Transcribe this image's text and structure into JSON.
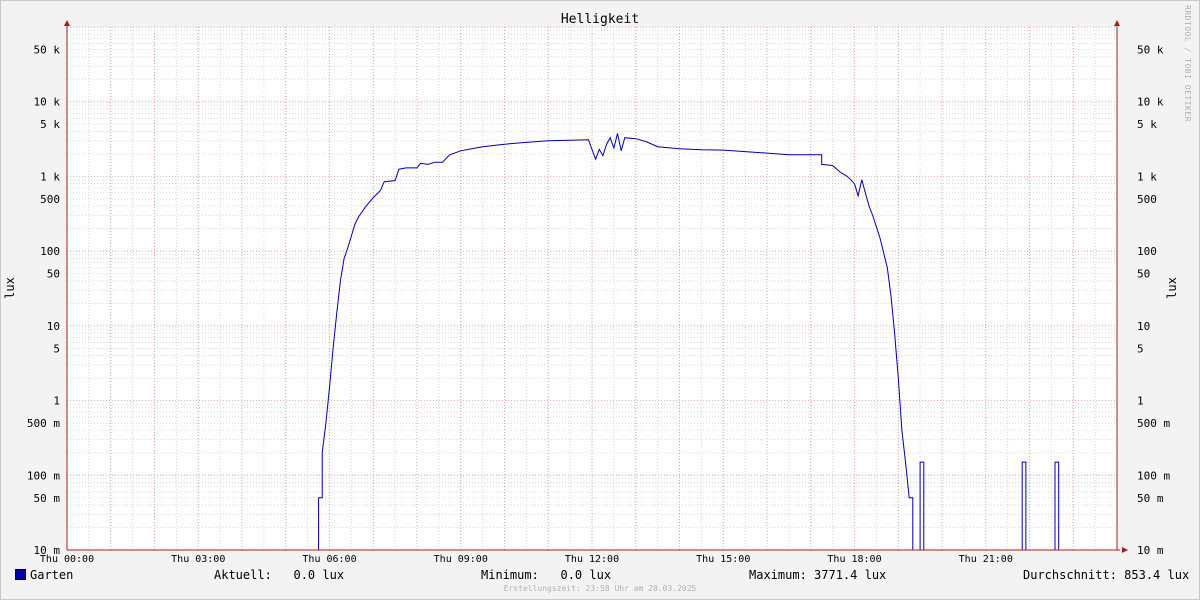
{
  "chart_data": {
    "type": "line",
    "title": "Helligkeit",
    "ylabel": "lux",
    "yscale": "log",
    "ylim": [
      0.01,
      100000
    ],
    "xlim": [
      "Thu 00:00",
      "Thu 24:00"
    ],
    "x_tick_labels": [
      "Thu 00:00",
      "Thu 03:00",
      "Thu 06:00",
      "Thu 09:00",
      "Thu 12:00",
      "Thu 15:00",
      "Thu 18:00",
      "Thu 21:00"
    ],
    "y_ticks": [
      {
        "v": 50000,
        "label": "50 k"
      },
      {
        "v": 10000,
        "label": "10 k"
      },
      {
        "v": 5000,
        "label": "5 k"
      },
      {
        "v": 1000,
        "label": "1 k"
      },
      {
        "v": 500,
        "label": "500"
      },
      {
        "v": 100,
        "label": "100"
      },
      {
        "v": 50,
        "label": "50"
      },
      {
        "v": 10,
        "label": "10"
      },
      {
        "v": 5,
        "label": "5"
      },
      {
        "v": 1,
        "label": "1"
      },
      {
        "v": 0.5,
        "label": "500 m"
      },
      {
        "v": 0.1,
        "label": "100 m"
      },
      {
        "v": 0.05,
        "label": "50 m"
      },
      {
        "v": 0.01,
        "label": "10 m"
      }
    ],
    "grid": true,
    "legend_position": "bottom-left",
    "colors": {
      "series": "#0000aa",
      "grid_major": "#e8a0a0",
      "grid_minor": "#d8d8d8",
      "axis": "#a02020"
    },
    "series": [
      {
        "name": "Garten",
        "points": [
          [
            "00:00",
            0.01
          ],
          [
            "05:45",
            0.01
          ],
          [
            "05:45",
            0.05
          ],
          [
            "05:50",
            0.05
          ],
          [
            "05:50",
            0.2
          ],
          [
            "05:55",
            0.5
          ],
          [
            "06:00",
            1.5
          ],
          [
            "06:05",
            5
          ],
          [
            "06:10",
            15
          ],
          [
            "06:15",
            40
          ],
          [
            "06:20",
            80
          ],
          [
            "06:25",
            110
          ],
          [
            "06:30",
            160
          ],
          [
            "06:35",
            230
          ],
          [
            "06:40",
            290
          ],
          [
            "06:50",
            400
          ],
          [
            "07:00",
            520
          ],
          [
            "07:10",
            650
          ],
          [
            "07:15",
            850
          ],
          [
            "07:30",
            880
          ],
          [
            "07:35",
            1250
          ],
          [
            "07:45",
            1300
          ],
          [
            "08:00",
            1300
          ],
          [
            "08:05",
            1500
          ],
          [
            "08:15",
            1450
          ],
          [
            "08:25",
            1550
          ],
          [
            "08:35",
            1550
          ],
          [
            "08:45",
            1950
          ],
          [
            "09:00",
            2200
          ],
          [
            "09:15",
            2350
          ],
          [
            "09:30",
            2500
          ],
          [
            "10:00",
            2700
          ],
          [
            "10:30",
            2850
          ],
          [
            "11:00",
            3000
          ],
          [
            "11:30",
            3050
          ],
          [
            "11:55",
            3100
          ],
          [
            "12:05",
            1700
          ],
          [
            "12:10",
            2300
          ],
          [
            "12:15",
            1900
          ],
          [
            "12:20",
            2700
          ],
          [
            "12:25",
            3300
          ],
          [
            "12:30",
            2400
          ],
          [
            "12:35",
            3771.4
          ],
          [
            "12:40",
            2200
          ],
          [
            "12:45",
            3300
          ],
          [
            "13:00",
            3200
          ],
          [
            "13:15",
            2900
          ],
          [
            "13:30",
            2500
          ],
          [
            "14:00",
            2350
          ],
          [
            "14:30",
            2280
          ],
          [
            "15:00",
            2250
          ],
          [
            "15:30",
            2150
          ],
          [
            "16:00",
            2050
          ],
          [
            "16:30",
            1950
          ],
          [
            "17:15",
            1950
          ],
          [
            "17:15",
            1450
          ],
          [
            "17:30",
            1400
          ],
          [
            "17:40",
            1150
          ],
          [
            "17:50",
            1000
          ],
          [
            "17:55",
            900
          ],
          [
            "18:00",
            800
          ],
          [
            "18:05",
            550
          ],
          [
            "18:10",
            900
          ],
          [
            "18:15",
            600
          ],
          [
            "18:20",
            400
          ],
          [
            "18:25",
            300
          ],
          [
            "18:35",
            150
          ],
          [
            "18:45",
            60
          ],
          [
            "18:50",
            25
          ],
          [
            "18:55",
            8
          ],
          [
            "19:00",
            2
          ],
          [
            "19:05",
            0.4
          ],
          [
            "19:10",
            0.15
          ],
          [
            "19:15",
            0.05
          ],
          [
            "19:20",
            0.05
          ],
          [
            "19:20",
            0.01
          ],
          [
            "19:30",
            0.01
          ],
          [
            "19:30",
            0.15
          ],
          [
            "19:35",
            0.15
          ],
          [
            "19:35",
            0.01
          ],
          [
            "21:50",
            0.01
          ],
          [
            "21:50",
            0.15
          ],
          [
            "21:55",
            0.15
          ],
          [
            "21:55",
            0.01
          ],
          [
            "22:35",
            0.01
          ],
          [
            "22:35",
            0.15
          ],
          [
            "22:40",
            0.15
          ],
          [
            "22:40",
            0.01
          ],
          [
            "24:00",
            0.01
          ]
        ]
      }
    ]
  },
  "legend": {
    "series_name": "Garten",
    "current": "Aktuell:   0.0 lux",
    "minimum": "Minimum:   0.0 lux",
    "maximum": "Maximum: 3771.4 lux",
    "average": "Durchschnitt: 853.4 lux"
  },
  "footer": "Erstellungszeit: 23:58 Uhr am 20.03.2025",
  "credit": "RRDTOOL / TOBI OETIKER"
}
